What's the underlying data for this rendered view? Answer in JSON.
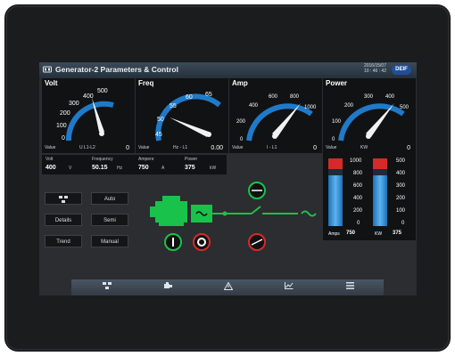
{
  "window": {
    "title": "Generator-2 Parameters & Control",
    "date": "2016/15/07",
    "time": "10 : 46 : 42",
    "brand": "DEIF"
  },
  "gauges": [
    {
      "title": "Volt",
      "ticks": [
        "0",
        "100",
        "200",
        "300",
        "400",
        "500"
      ],
      "value_label": "Value",
      "unit": "U L1-L2",
      "value": "0",
      "reading": 405
    },
    {
      "title": "Freq",
      "ticks": [
        "45",
        "50",
        "55",
        "60",
        "65"
      ],
      "value_label": "Value",
      "unit": "Hz - L1",
      "value": "0.00",
      "reading": 50.15
    },
    {
      "title": "Amp",
      "ticks": [
        "0",
        "200",
        "400",
        "600",
        "800",
        "1000"
      ],
      "value_label": "Value",
      "unit": "I - L1",
      "value": "0",
      "reading": 750
    },
    {
      "title": "Power",
      "ticks": [
        "0",
        "100",
        "200",
        "300",
        "400",
        "500"
      ],
      "value_label": "Value",
      "unit": "KW",
      "value": "0",
      "reading": 375
    }
  ],
  "readings": {
    "volt": {
      "label": "Volt",
      "value": "400",
      "unit": "V"
    },
    "frequency": {
      "label": "Frequency",
      "value": "50.15",
      "unit": "Hz"
    },
    "ampere": {
      "label": "Ampere",
      "value": "750",
      "unit": "A"
    },
    "power": {
      "label": "Power",
      "value": "375",
      "unit": "kW"
    }
  },
  "buttons": {
    "auto": "Auto",
    "details": "Details",
    "semi": "Semi",
    "trend": "Trend",
    "manual": "Manual"
  },
  "bar_indicators": {
    "amps": {
      "ticks": [
        "1000",
        "800",
        "600",
        "400",
        "200",
        "0"
      ],
      "label": "Amps",
      "value": "750",
      "level": 0.75
    },
    "kw": {
      "ticks": [
        "500",
        "400",
        "300",
        "200",
        "100",
        "0"
      ],
      "label": "KW",
      "value": "375",
      "level": 0.75
    }
  },
  "colors": {
    "accent_green": "#19c24a",
    "gauge_blue": "#1f7ac9",
    "bar_red": "#d62a2a",
    "bar_blue": "#2e8fd8"
  },
  "nav": {
    "items": [
      "diagram-icon",
      "generator-icon",
      "warning-icon",
      "trend-icon",
      "menu-icon"
    ]
  }
}
